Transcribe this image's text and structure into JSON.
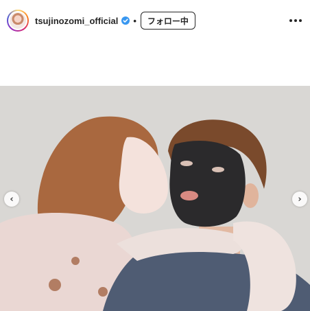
{
  "post": {
    "username": "tsujinozomi_official",
    "verified": true,
    "separator": "•",
    "follow_label": "フォロー中",
    "more_icon": "more-horizontal-icon"
  },
  "carousel": {
    "prev_glyph": "‹",
    "next_glyph": "›"
  },
  "colors": {
    "verified_blue": "#3897f0",
    "text": "#262626",
    "background": "#ffffff"
  }
}
